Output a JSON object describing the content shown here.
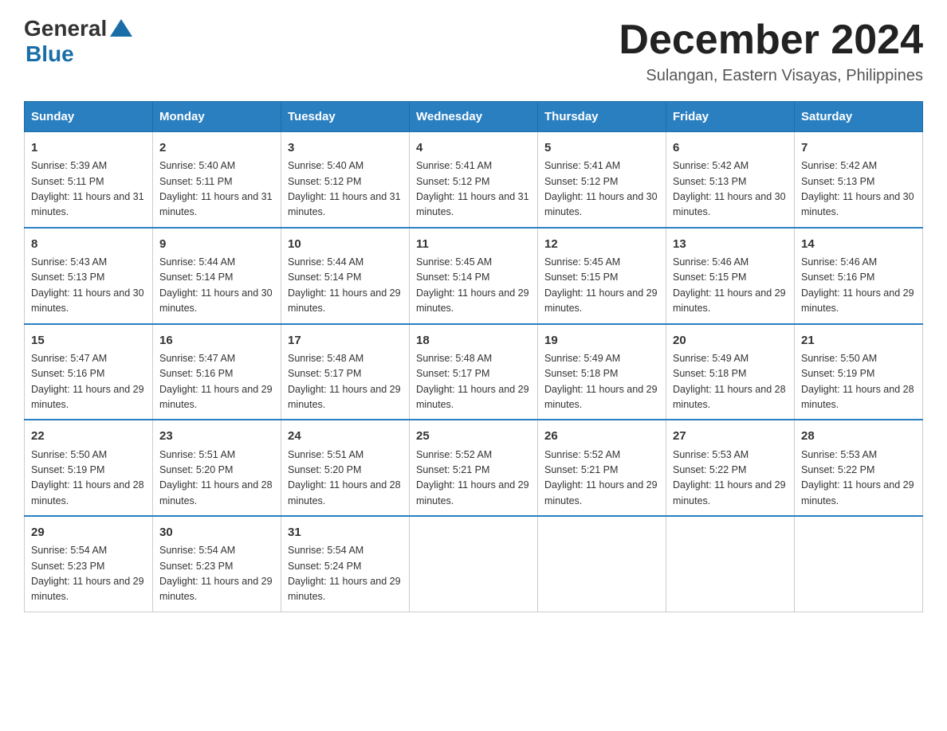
{
  "logo": {
    "general": "General",
    "blue": "Blue"
  },
  "title": "December 2024",
  "location": "Sulangan, Eastern Visayas, Philippines",
  "weekdays": [
    "Sunday",
    "Monday",
    "Tuesday",
    "Wednesday",
    "Thursday",
    "Friday",
    "Saturday"
  ],
  "weeks": [
    [
      {
        "day": "1",
        "sunrise": "5:39 AM",
        "sunset": "5:11 PM",
        "daylight": "11 hours and 31 minutes."
      },
      {
        "day": "2",
        "sunrise": "5:40 AM",
        "sunset": "5:11 PM",
        "daylight": "11 hours and 31 minutes."
      },
      {
        "day": "3",
        "sunrise": "5:40 AM",
        "sunset": "5:12 PM",
        "daylight": "11 hours and 31 minutes."
      },
      {
        "day": "4",
        "sunrise": "5:41 AM",
        "sunset": "5:12 PM",
        "daylight": "11 hours and 31 minutes."
      },
      {
        "day": "5",
        "sunrise": "5:41 AM",
        "sunset": "5:12 PM",
        "daylight": "11 hours and 30 minutes."
      },
      {
        "day": "6",
        "sunrise": "5:42 AM",
        "sunset": "5:13 PM",
        "daylight": "11 hours and 30 minutes."
      },
      {
        "day": "7",
        "sunrise": "5:42 AM",
        "sunset": "5:13 PM",
        "daylight": "11 hours and 30 minutes."
      }
    ],
    [
      {
        "day": "8",
        "sunrise": "5:43 AM",
        "sunset": "5:13 PM",
        "daylight": "11 hours and 30 minutes."
      },
      {
        "day": "9",
        "sunrise": "5:44 AM",
        "sunset": "5:14 PM",
        "daylight": "11 hours and 30 minutes."
      },
      {
        "day": "10",
        "sunrise": "5:44 AM",
        "sunset": "5:14 PM",
        "daylight": "11 hours and 29 minutes."
      },
      {
        "day": "11",
        "sunrise": "5:45 AM",
        "sunset": "5:14 PM",
        "daylight": "11 hours and 29 minutes."
      },
      {
        "day": "12",
        "sunrise": "5:45 AM",
        "sunset": "5:15 PM",
        "daylight": "11 hours and 29 minutes."
      },
      {
        "day": "13",
        "sunrise": "5:46 AM",
        "sunset": "5:15 PM",
        "daylight": "11 hours and 29 minutes."
      },
      {
        "day": "14",
        "sunrise": "5:46 AM",
        "sunset": "5:16 PM",
        "daylight": "11 hours and 29 minutes."
      }
    ],
    [
      {
        "day": "15",
        "sunrise": "5:47 AM",
        "sunset": "5:16 PM",
        "daylight": "11 hours and 29 minutes."
      },
      {
        "day": "16",
        "sunrise": "5:47 AM",
        "sunset": "5:16 PM",
        "daylight": "11 hours and 29 minutes."
      },
      {
        "day": "17",
        "sunrise": "5:48 AM",
        "sunset": "5:17 PM",
        "daylight": "11 hours and 29 minutes."
      },
      {
        "day": "18",
        "sunrise": "5:48 AM",
        "sunset": "5:17 PM",
        "daylight": "11 hours and 29 minutes."
      },
      {
        "day": "19",
        "sunrise": "5:49 AM",
        "sunset": "5:18 PM",
        "daylight": "11 hours and 29 minutes."
      },
      {
        "day": "20",
        "sunrise": "5:49 AM",
        "sunset": "5:18 PM",
        "daylight": "11 hours and 28 minutes."
      },
      {
        "day": "21",
        "sunrise": "5:50 AM",
        "sunset": "5:19 PM",
        "daylight": "11 hours and 28 minutes."
      }
    ],
    [
      {
        "day": "22",
        "sunrise": "5:50 AM",
        "sunset": "5:19 PM",
        "daylight": "11 hours and 28 minutes."
      },
      {
        "day": "23",
        "sunrise": "5:51 AM",
        "sunset": "5:20 PM",
        "daylight": "11 hours and 28 minutes."
      },
      {
        "day": "24",
        "sunrise": "5:51 AM",
        "sunset": "5:20 PM",
        "daylight": "11 hours and 28 minutes."
      },
      {
        "day": "25",
        "sunrise": "5:52 AM",
        "sunset": "5:21 PM",
        "daylight": "11 hours and 29 minutes."
      },
      {
        "day": "26",
        "sunrise": "5:52 AM",
        "sunset": "5:21 PM",
        "daylight": "11 hours and 29 minutes."
      },
      {
        "day": "27",
        "sunrise": "5:53 AM",
        "sunset": "5:22 PM",
        "daylight": "11 hours and 29 minutes."
      },
      {
        "day": "28",
        "sunrise": "5:53 AM",
        "sunset": "5:22 PM",
        "daylight": "11 hours and 29 minutes."
      }
    ],
    [
      {
        "day": "29",
        "sunrise": "5:54 AM",
        "sunset": "5:23 PM",
        "daylight": "11 hours and 29 minutes."
      },
      {
        "day": "30",
        "sunrise": "5:54 AM",
        "sunset": "5:23 PM",
        "daylight": "11 hours and 29 minutes."
      },
      {
        "day": "31",
        "sunrise": "5:54 AM",
        "sunset": "5:24 PM",
        "daylight": "11 hours and 29 minutes."
      },
      null,
      null,
      null,
      null
    ]
  ],
  "labels": {
    "sunrise": "Sunrise:",
    "sunset": "Sunset:",
    "daylight": "Daylight:"
  }
}
